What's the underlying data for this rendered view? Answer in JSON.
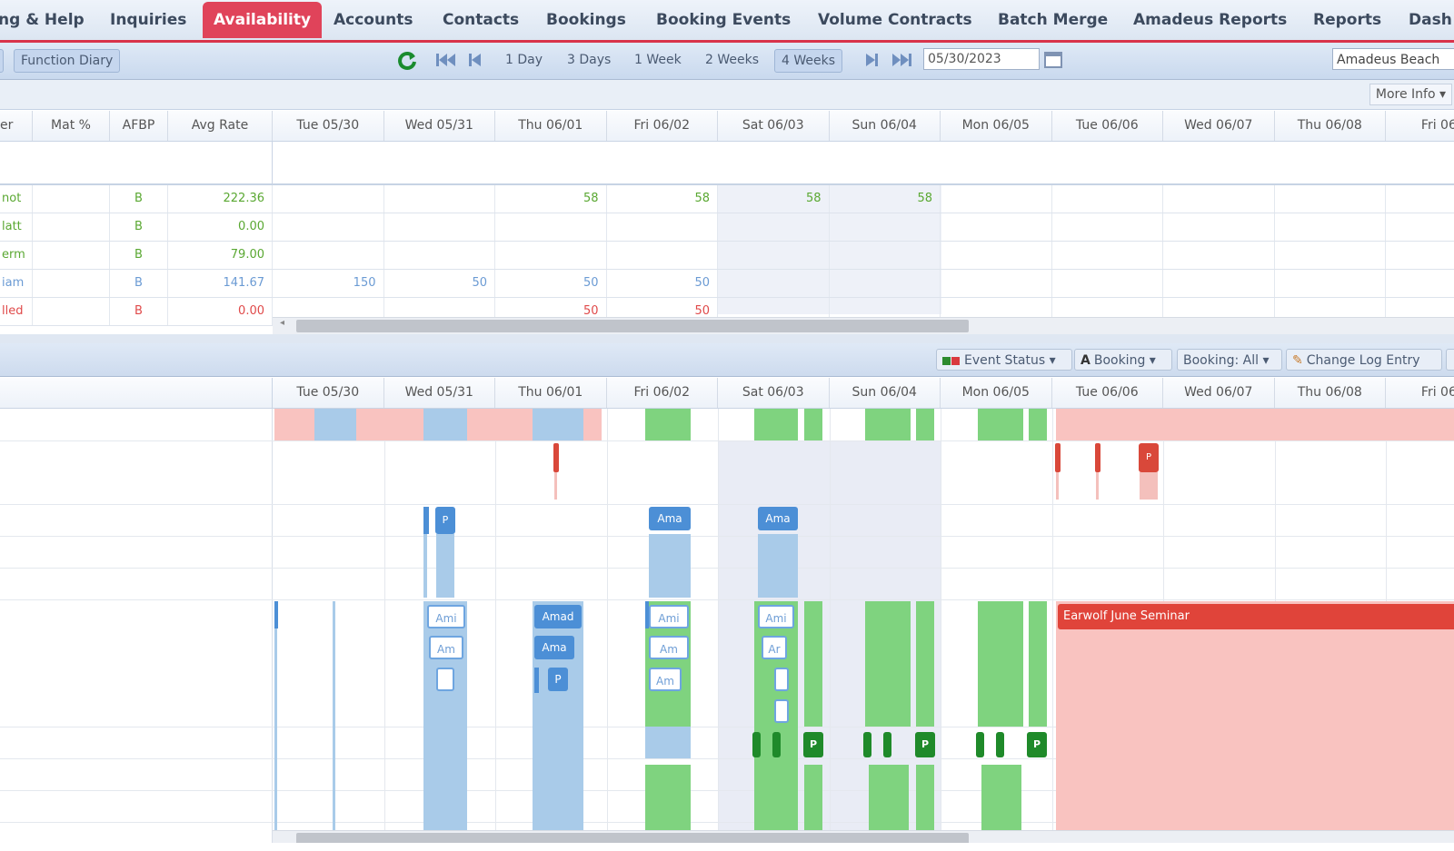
{
  "nav": {
    "tabs": [
      "ng & Help",
      "Inquiries",
      "Availability",
      "Accounts",
      "Contacts",
      "Bookings",
      "Booking Events",
      "Volume Contracts",
      "Batch Merge",
      "Amadeus Reports",
      "Reports",
      "Dash"
    ]
  },
  "toolbar": {
    "function_diary": "Function Diary",
    "ranges": [
      "1 Day",
      "3 Days",
      "1 Week",
      "2 Weeks",
      "4 Weeks"
    ],
    "date": "05/30/2023",
    "property": "Amadeus Beach"
  },
  "more_info": "More Info",
  "grid": {
    "columns": [
      "er",
      "Mat %",
      "AFBP",
      "Avg Rate"
    ],
    "days": [
      "Tue 05/30",
      "Wed 05/31",
      "Thu 06/01",
      "Fri 06/02",
      "Sat 06/03",
      "Sun 06/04",
      "Mon 06/05",
      "Tue 06/06",
      "Wed 06/07",
      "Thu 06/08",
      "Fri 06/"
    ],
    "rows": [
      {
        "name": "not",
        "afbp": "B",
        "rate": "222.36",
        "vals": [
          "",
          "",
          "58",
          "58",
          "58",
          "58",
          "",
          "",
          "",
          "",
          ""
        ],
        "color": "green"
      },
      {
        "name": "latt",
        "afbp": "B",
        "rate": "0.00",
        "vals": [
          "",
          "",
          "",
          "",
          "",
          "",
          "",
          "",
          "",
          "",
          ""
        ],
        "color": "green"
      },
      {
        "name": "erm",
        "afbp": "B",
        "rate": "79.00",
        "vals": [
          "",
          "",
          "",
          "",
          "",
          "",
          "",
          "",
          "",
          "",
          ""
        ],
        "color": "green"
      },
      {
        "name": "iam",
        "afbp": "B",
        "rate": "141.67",
        "vals": [
          "150",
          "50",
          "50",
          "50",
          "",
          "",
          "",
          "",
          "",
          "",
          ""
        ],
        "color": "blue"
      },
      {
        "name": "lled",
        "afbp": "B",
        "rate": "0.00",
        "vals": [
          "",
          "",
          "50",
          "50",
          "",
          "",
          "",
          "",
          "",
          "",
          ""
        ],
        "color": "red"
      }
    ]
  },
  "eventbar": {
    "event_status": "Event Status",
    "booking": "Booking",
    "booking_all": "Booking: All",
    "change_log": "Change Log Entry"
  },
  "diary": {
    "days": [
      "Tue 05/30",
      "Wed 05/31",
      "Thu 06/01",
      "Fri 06/02",
      "Sat 06/03",
      "Sun 06/04",
      "Mon 06/05",
      "Tue 06/06",
      "Wed 06/07",
      "Thu 06/08",
      "Fri 06/"
    ],
    "event_title": "Earwolf June Seminar",
    "tags": {
      "ama": "Ama",
      "amad": "Amad",
      "am": "Am",
      "ami": "Ami",
      "a": "A",
      "ar": "Ar",
      "p": "P"
    }
  },
  "colors": {
    "accent": "#e0435a",
    "green": "#7fd37f",
    "blue": "#a9cbe9",
    "pink": "#f9c3c0",
    "red_event": "#e0443a"
  }
}
